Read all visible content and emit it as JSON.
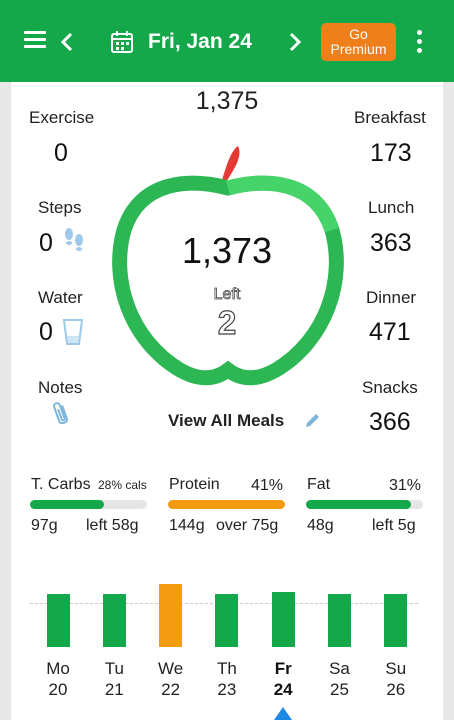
{
  "header": {
    "date": "Fri, Jan 24",
    "premium_line1": "Go",
    "premium_line2": "Premium",
    "accent": "#14a84a"
  },
  "summary": {
    "goal": "1,375",
    "remaining": "1,373",
    "left_label": "Left",
    "left_value": "2"
  },
  "left_stats": {
    "exercise_label": "Exercise",
    "exercise_value": "0",
    "steps_label": "Steps",
    "steps_value": "0",
    "water_label": "Water",
    "water_value": "0",
    "notes_label": "Notes"
  },
  "meals": {
    "breakfast_label": "Breakfast",
    "breakfast_value": "173",
    "lunch_label": "Lunch",
    "lunch_value": "363",
    "dinner_label": "Dinner",
    "dinner_value": "471",
    "snacks_label": "Snacks",
    "snacks_value": "366",
    "view_all": "View All Meals"
  },
  "macros": {
    "carbs": {
      "title": "T. Carbs",
      "pct": "28% cals",
      "amount": "97g",
      "status": "left 58g",
      "progress": 0.63,
      "color": "#14a84a"
    },
    "protein": {
      "title": "Protein",
      "pct": "41%",
      "amount": "144g",
      "status": "over 75g",
      "progress": 1.0,
      "color": "#f39c12"
    },
    "fat": {
      "title": "Fat",
      "pct": "31%",
      "amount": "48g",
      "status": "left 5g",
      "progress": 0.9,
      "color": "#14a84a"
    }
  },
  "week": [
    {
      "day": "Mo",
      "date": "20",
      "level": 0.75,
      "over": false,
      "selected": false
    },
    {
      "day": "Tu",
      "date": "21",
      "level": 0.75,
      "over": false,
      "selected": false
    },
    {
      "day": "We",
      "date": "22",
      "level": 0.9,
      "over": true,
      "selected": false
    },
    {
      "day": "Th",
      "date": "23",
      "level": 0.75,
      "over": false,
      "selected": false
    },
    {
      "day": "Fr",
      "date": "24",
      "level": 0.78,
      "over": false,
      "selected": true
    },
    {
      "day": "Sa",
      "date": "25",
      "level": 0.75,
      "over": false,
      "selected": false
    },
    {
      "day": "Su",
      "date": "26",
      "level": 0.75,
      "over": false,
      "selected": false
    }
  ]
}
